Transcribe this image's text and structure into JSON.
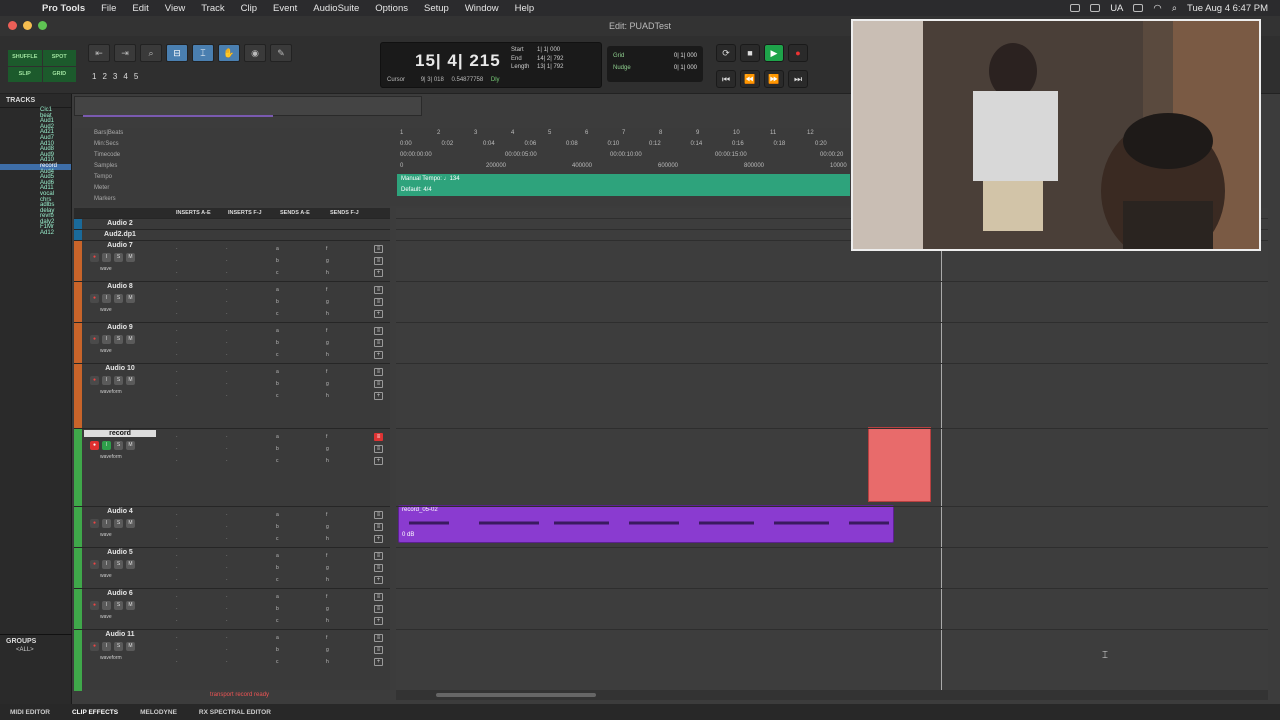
{
  "menubar": {
    "app": "Pro Tools",
    "items": [
      "File",
      "Edit",
      "View",
      "Track",
      "Clip",
      "Event",
      "AudioSuite",
      "Options",
      "Setup",
      "Window",
      "Help"
    ],
    "ua": "UA",
    "clock": "Tue Aug 4  6:47 PM"
  },
  "window": {
    "title": "Edit: PUADTest"
  },
  "modes": [
    "SHUFFLE",
    "SPOT",
    "SLIP",
    "GRID"
  ],
  "toolbar": {
    "zoom_presets": [
      "1",
      "2",
      "3",
      "4",
      "5"
    ],
    "counter_main": "15| 4| 215",
    "sel_labels": [
      "Start",
      "End",
      "Length"
    ],
    "sel_values": [
      "1| 1| 000",
      "14| 2| 792",
      "13| 1| 792"
    ],
    "cursor_label": "Cursor",
    "cursor_value": "9| 3| 018",
    "cursor_sample": "0.54877758",
    "dly_label": "Dly",
    "grid_label": "Grid",
    "grid_value": "0| 1| 000",
    "nudge_label": "Nudge",
    "nudge_value": "0| 1| 000"
  },
  "tracklist": {
    "header": "TRACKS",
    "items": [
      "Clc1",
      "beat",
      "Aud1",
      "Aud2",
      "Ad21",
      "Aud7",
      "Ad10",
      "Aud8",
      "Aud9",
      "Ad10",
      "record",
      "Aud4",
      "Aud5",
      "Aud6",
      "Ad11",
      "vocal",
      "chrs",
      "adlbs",
      "delay",
      "revrb",
      "daly2",
      "F1Mr",
      "Ad12"
    ],
    "groups_header": "GROUPS",
    "groups_all": "<ALL>"
  },
  "rulers": {
    "labels": [
      "Bars|Beats",
      "Min:Secs",
      "Timecode",
      "Samples",
      "Tempo",
      "Meter",
      "Markers"
    ],
    "bars": [
      "1",
      "2",
      "3",
      "4",
      "5",
      "6",
      "7",
      "8",
      "9",
      "10",
      "11",
      "12"
    ],
    "minsecs": [
      "0:00",
      "0:02",
      "0:04",
      "0:06",
      "0:08",
      "0:10",
      "0:12",
      "0:14",
      "0:16",
      "0:18",
      "0:20"
    ],
    "timecode": [
      "00:00:00:00",
      "00:00:05:00",
      "00:00:10:00",
      "00:00:15:00",
      "00:00:20"
    ],
    "samples": [
      "0",
      "200000",
      "400000",
      "600000",
      "800000",
      "10000"
    ],
    "tempo_text": "Manual Tempo: ♩134",
    "meter_text": "Default: 4/4"
  },
  "columns": [
    "INSERTS A-E",
    "INSERTS F-J",
    "SENDS A-E",
    "SENDS F-J"
  ],
  "tracks": [
    {
      "name": "Audio 2",
      "view": "",
      "color": "#1a6a9a"
    },
    {
      "name": "Aud2.dp1",
      "view": "",
      "color": "#1a6a9a"
    },
    {
      "name": "Audio 7",
      "view": "wave",
      "color": "#c8642a"
    },
    {
      "name": "Audio 8",
      "view": "wave",
      "color": "#c8642a"
    },
    {
      "name": "Audio 9",
      "view": "wave",
      "color": "#c8642a"
    },
    {
      "name": "Audio 10",
      "view": "waveform",
      "color": "#c8642a"
    },
    {
      "name": "record",
      "view": "waveform",
      "color": "#3fa84a"
    },
    {
      "name": "Audio 4",
      "view": "wave",
      "color": "#3fa84a"
    },
    {
      "name": "Audio 5",
      "view": "wave",
      "color": "#3fa84a"
    },
    {
      "name": "Audio 6",
      "view": "wave",
      "color": "#3fa84a"
    },
    {
      "name": "Audio 11",
      "view": "waveform",
      "color": "#3fa84a"
    }
  ],
  "clip": {
    "name": "record_05-02",
    "gain": "0 dB"
  },
  "status": "transport record ready",
  "bottom": [
    "MIDI EDITOR",
    "CLIP EFFECTS",
    "MELODYNE",
    "RX SPECTRAL EDITOR"
  ],
  "colors": {
    "tempo": "#2ea37c",
    "clip": "#8a3bd0",
    "record_block": "#e86b6b",
    "selected_track": "#3e6ea8"
  }
}
